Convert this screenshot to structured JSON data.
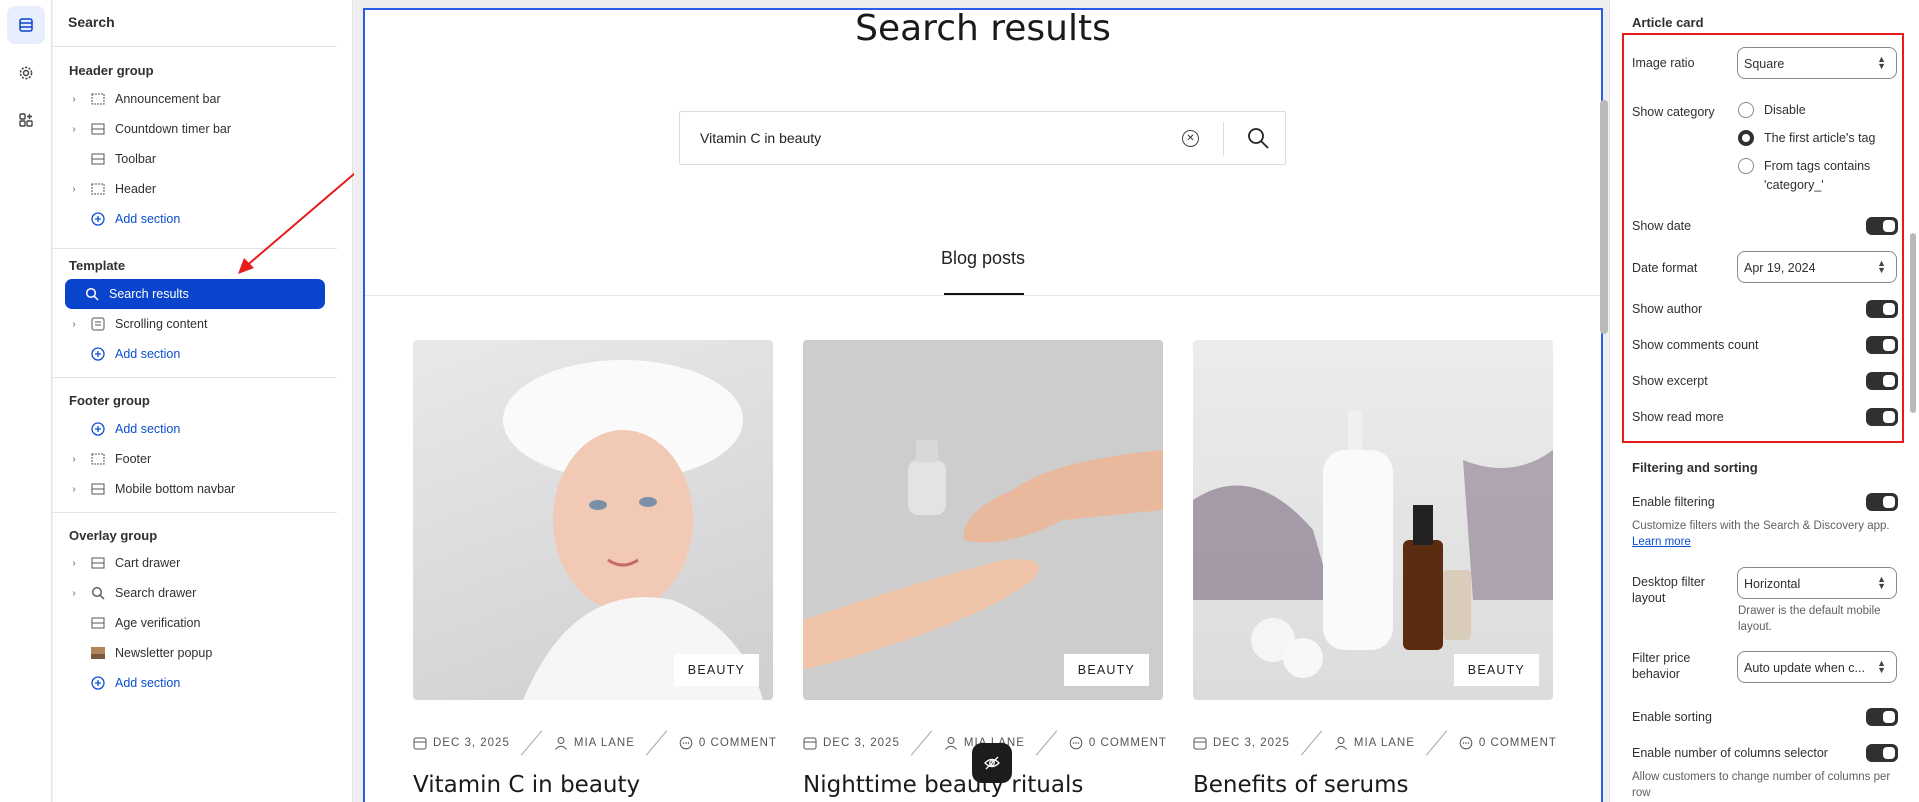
{
  "left_panel": {
    "title": "Search",
    "groups": {
      "header": {
        "title": "Header group",
        "items": [
          "Announcement bar",
          "Countdown timer bar",
          "Toolbar",
          "Header"
        ],
        "add": "Add section"
      },
      "template": {
        "title": "Template",
        "items": [
          "Search results",
          "Scrolling content"
        ],
        "add": "Add section"
      },
      "footer": {
        "title": "Footer group",
        "add": "Add section",
        "items": [
          "Footer",
          "Mobile bottom navbar"
        ]
      },
      "overlay": {
        "title": "Overlay group",
        "items": [
          "Cart drawer",
          "Search drawer",
          "Age verification",
          "Newsletter popup"
        ],
        "add": "Add section"
      }
    }
  },
  "preview": {
    "heading": "Search results",
    "search_value": "Vitamin C in beauty",
    "tab": "Blog posts",
    "cards": [
      {
        "badge": "BEAUTY",
        "date": "DEC 3, 2025",
        "author": "MIA LANE",
        "comments": "0 COMMENT",
        "title": "Vitamin C in beauty"
      },
      {
        "badge": "BEAUTY",
        "date": "DEC 3, 2025",
        "author": "MIA LANE",
        "comments": "0 COMMENT",
        "title": "Nighttime beauty rituals"
      },
      {
        "badge": "BEAUTY",
        "date": "DEC 3, 2025",
        "author": "MIA LANE",
        "comments": "0 COMMENT",
        "title": "Benefits of serums"
      }
    ]
  },
  "right_panel": {
    "article_card": {
      "title": "Article card",
      "image_ratio": {
        "label": "Image ratio",
        "value": "Square"
      },
      "show_category": {
        "label": "Show category",
        "options": [
          "Disable",
          "The first article's tag",
          "From tags contains",
          "'category_'"
        ],
        "selected": 1
      },
      "show_date": "Show date",
      "date_format": {
        "label": "Date format",
        "value": "Apr 19, 2024"
      },
      "show_author": "Show author",
      "show_comments": "Show comments count",
      "show_excerpt": "Show excerpt",
      "show_read_more": "Show read more"
    },
    "filtering": {
      "title": "Filtering and sorting",
      "enable_filtering": "Enable filtering",
      "filter_hint": "Customize filters with the Search & Discovery app.",
      "learn_more": "Learn more",
      "desktop_layout": {
        "label_1": "Desktop filter",
        "label_2": "layout",
        "value": "Horizontal",
        "hint_1": "Drawer is the default mobile",
        "hint_2": "layout."
      },
      "price_behavior": {
        "label_1": "Filter price",
        "label_2": "behavior",
        "value": "Auto update when c..."
      },
      "enable_sorting": "Enable sorting",
      "columns_selector": "Enable number of columns selector",
      "columns_hint_1": "Allow customers to change number of columns per",
      "columns_hint_2": "row"
    }
  },
  "colors": {
    "accent": "#0b44cc",
    "annotation": "#e81b1b"
  }
}
